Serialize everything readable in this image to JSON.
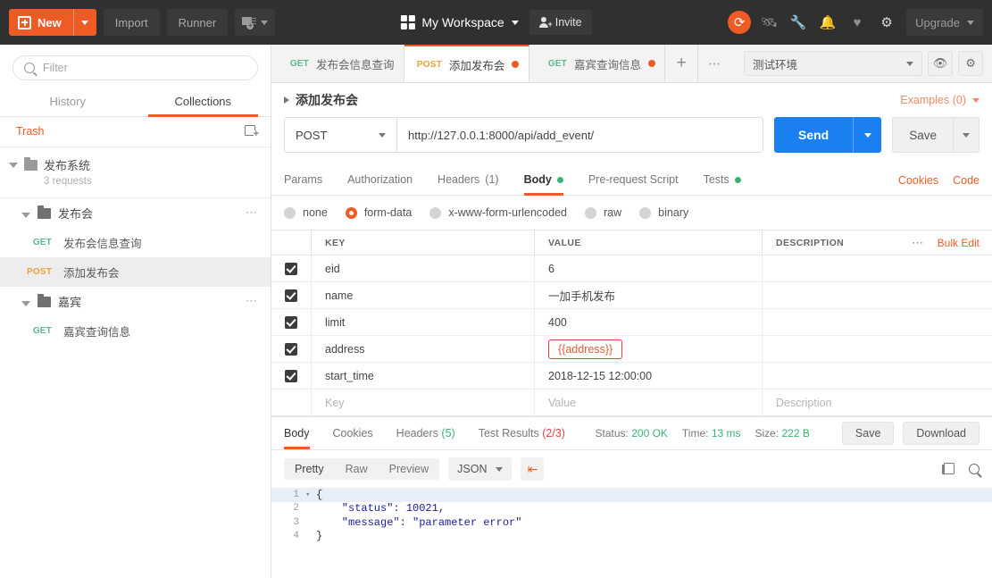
{
  "topbar": {
    "new_label": "New",
    "import_label": "Import",
    "runner_label": "Runner",
    "workspace_label": "My Workspace",
    "invite_label": "Invite",
    "upgrade_label": "Upgrade",
    "icons": [
      "sync-icon",
      "satellite-icon",
      "wrench-icon",
      "bell-icon",
      "heart-icon",
      "gear-icon"
    ]
  },
  "sidebar": {
    "filter_placeholder": "Filter",
    "tabs": [
      {
        "label": "History",
        "active": false
      },
      {
        "label": "Collections",
        "active": true
      }
    ],
    "trash_label": "Trash",
    "collection": {
      "name": "发布系统",
      "requests_count": "3 requests"
    },
    "folders": [
      {
        "name": "发布会",
        "requests": [
          {
            "method": "GET",
            "name": "发布会信息查询",
            "selected": false
          },
          {
            "method": "POST",
            "name": "添加发布会",
            "selected": true
          }
        ]
      },
      {
        "name": "嘉宾",
        "requests": [
          {
            "method": "GET",
            "name": "嘉宾查询信息",
            "selected": false
          }
        ]
      }
    ]
  },
  "tabstrip": {
    "tabs": [
      {
        "method": "GET",
        "name": "发布会信息查询",
        "active": false,
        "unsaved": false
      },
      {
        "method": "POST",
        "name": "添加发布会",
        "active": true,
        "unsaved": true
      },
      {
        "method": "GET",
        "name": "嘉宾查询信息",
        "active": false,
        "unsaved": true
      }
    ],
    "environment": "测试环境"
  },
  "request": {
    "breadcrumb_title": "添加发布会",
    "examples_label": "Examples (0)",
    "method": "POST",
    "url": "http://127.0.0.1:8000/api/add_event/",
    "send_label": "Send",
    "save_label": "Save",
    "tabs": [
      {
        "label": "Params",
        "active": false,
        "dot": false,
        "count": ""
      },
      {
        "label": "Authorization",
        "active": false,
        "dot": false,
        "count": ""
      },
      {
        "label": "Headers",
        "active": false,
        "dot": false,
        "count": "(1)"
      },
      {
        "label": "Body",
        "active": true,
        "dot": true,
        "count": ""
      },
      {
        "label": "Pre-request Script",
        "active": false,
        "dot": false,
        "count": ""
      },
      {
        "label": "Tests",
        "active": false,
        "dot": true,
        "count": ""
      }
    ],
    "cookies_label": "Cookies",
    "code_label": "Code",
    "body_types": [
      {
        "label": "none",
        "selected": false
      },
      {
        "label": "form-data",
        "selected": true
      },
      {
        "label": "x-www-form-urlencoded",
        "selected": false
      },
      {
        "label": "raw",
        "selected": false
      },
      {
        "label": "binary",
        "selected": false
      }
    ],
    "table": {
      "headers": {
        "key": "KEY",
        "value": "VALUE",
        "description": "DESCRIPTION"
      },
      "bulk_edit_label": "Bulk Edit",
      "rows": [
        {
          "checked": true,
          "key": "eid",
          "value": "6",
          "description": "",
          "invalid": false
        },
        {
          "checked": true,
          "key": "name",
          "value": "一加手机发布",
          "description": "",
          "invalid": false
        },
        {
          "checked": true,
          "key": "limit",
          "value": "400",
          "description": "",
          "invalid": false
        },
        {
          "checked": true,
          "key": "address",
          "value": "{{address}}",
          "description": "",
          "invalid": true
        },
        {
          "checked": true,
          "key": "start_time",
          "value": "2018-12-15 12:00:00",
          "description": "",
          "invalid": false
        }
      ],
      "placeholder_row": {
        "key": "Key",
        "value": "Value",
        "description": "Description"
      }
    }
  },
  "response": {
    "tabs": [
      {
        "label": "Body",
        "count": "",
        "active": true,
        "count_color": ""
      },
      {
        "label": "Cookies",
        "count": "",
        "active": false,
        "count_color": ""
      },
      {
        "label": "Headers",
        "count": "(5)",
        "active": false,
        "count_color": "green"
      },
      {
        "label": "Test Results",
        "count": "(2/3)",
        "active": false,
        "count_color": "red"
      }
    ],
    "status_label": "Status:",
    "status_value": "200 OK",
    "time_label": "Time:",
    "time_value": "13 ms",
    "size_label": "Size:",
    "size_value": "222 B",
    "save_label": "Save",
    "download_label": "Download",
    "view_modes": [
      {
        "label": "Pretty",
        "active": true
      },
      {
        "label": "Raw",
        "active": false
      },
      {
        "label": "Preview",
        "active": false
      }
    ],
    "format": "JSON",
    "body_lines": [
      {
        "num": "1",
        "foldable": true,
        "text": "{"
      },
      {
        "num": "2",
        "foldable": false,
        "text": "    \"status\": 10021,"
      },
      {
        "num": "3",
        "foldable": false,
        "text": "    \"message\": \"parameter error\""
      },
      {
        "num": "4",
        "foldable": false,
        "text": "}"
      }
    ]
  },
  "colors": {
    "accent": "#ef5b25",
    "send": "#1a7ff1",
    "get": "#5bb98c",
    "post": "#e8a33d",
    "ok": "#3bb273",
    "error": "#e04545"
  }
}
